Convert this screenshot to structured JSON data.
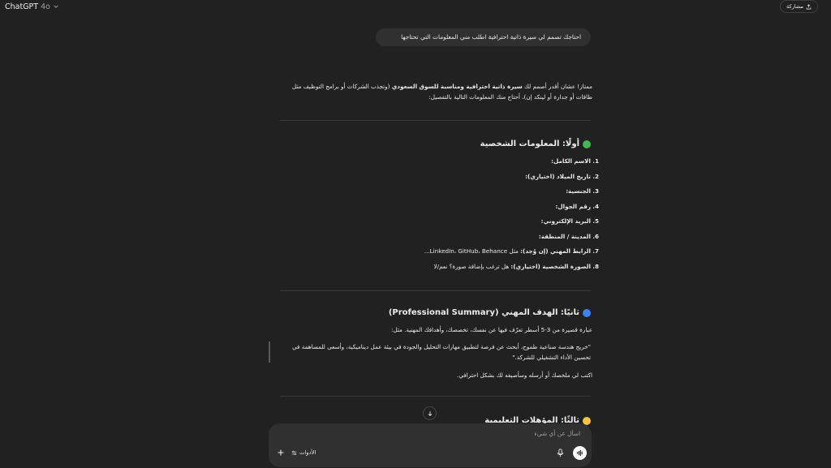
{
  "header": {
    "app_name": "ChatGPT",
    "model_version": "4o",
    "share_label": "مشاركة"
  },
  "chat": {
    "user_message": "احتاجك تصمم لي سيرة ذاتية احترافية اطلب مني المعلومات التي تحتاجها",
    "intro": {
      "part1": "ممتاز! عشان أقدر أصمم لك ",
      "bold1": "سيرة ذاتية احترافية ومناسبة للسوق السعودي",
      "part2": " (وتجذب الشركات أو برامج التوظيف مثل طاقات أو جدارة أو لينكد إن)، أحتاج منك المعلومات التالية بالتفصيل:"
    },
    "section1": {
      "title": "أولًا: المعلومات الشخصية",
      "items": [
        {
          "num": "1.",
          "label": "الاسم الكامل:",
          "detail": ""
        },
        {
          "num": "2.",
          "label": "تاريخ الميلاد (اختياري):",
          "detail": ""
        },
        {
          "num": "3.",
          "label": "الجنسية:",
          "detail": ""
        },
        {
          "num": "4.",
          "label": "رقم الجوال:",
          "detail": ""
        },
        {
          "num": "5.",
          "label": "البريد الإلكتروني:",
          "detail": ""
        },
        {
          "num": "6.",
          "label": "المدينة / المنطقة:",
          "detail": ""
        },
        {
          "num": "7.",
          "label": "الرابط المهني (إن وُجد):",
          "detail": " مثل LinkedIn، GitHub، Behance..."
        },
        {
          "num": "8.",
          "label": "الصورة الشخصية (اختياري):",
          "detail": " هل ترغب بإضافة صورة؟ نعم/لا"
        }
      ]
    },
    "section2": {
      "title": "ثانيًا: الهدف المهني (Professional Summary)",
      "description": "عبارة قصيرة من 3-5 أسطر تعرّف فيها عن نفسك، تخصصك، وأهدافك المهنية. مثل:",
      "quote": "\"خريج هندسة صناعية طموح، أبحث عن فرصة لتطبيق مهارات التحليل والجودة في بيئة عمل ديناميكية، وأسعى للمساهمة في تحسين الأداء التشغيلي للشركة.\"",
      "instruction": "اكتب لي ملخصك أو أرسله وسأصيغه لك بشكل احترافي."
    },
    "section3": {
      "title": "ثالثًا: المؤهلات التعليمية"
    }
  },
  "composer": {
    "placeholder": "اسأل عن أي شيء",
    "tools_label": "الأدوات"
  },
  "colors": {
    "background": "#212121",
    "bubble": "#303030",
    "green_dot": "#3fb950",
    "blue_dot": "#3b82f6",
    "yellow_dot": "#f5c542"
  }
}
